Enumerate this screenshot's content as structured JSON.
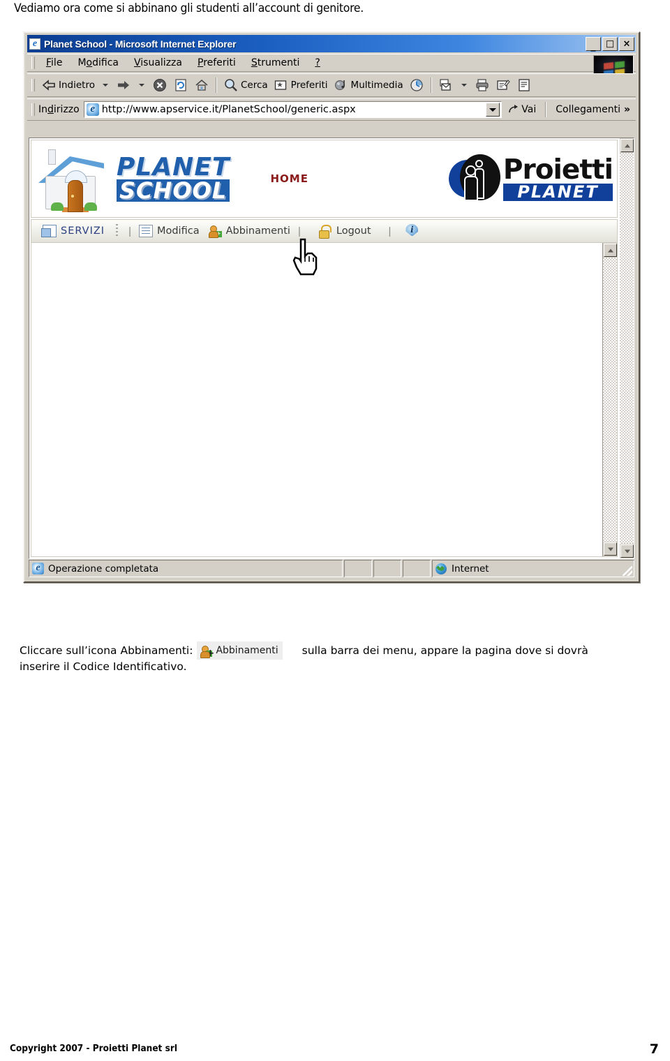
{
  "document": {
    "intro_text": "Vediamo ora come si abbinano gli studenti all’account di genitore.",
    "footer_copyright": "Copyright 2007 - Proietti Planet srl",
    "page_number": "7"
  },
  "browser": {
    "title": "Planet School - Microsoft Internet Explorer",
    "title_icon": "ie-document-icon",
    "window_controls": {
      "minimize": "_",
      "maximize": "□",
      "close": "×"
    },
    "menu": [
      {
        "label": "File",
        "accel": "F"
      },
      {
        "label": "Modifica",
        "accel": "M"
      },
      {
        "label": "Visualizza",
        "accel": "V"
      },
      {
        "label": "Preferiti",
        "accel": "P"
      },
      {
        "label": "Strumenti",
        "accel": "S"
      },
      {
        "label": "?",
        "accel": ""
      }
    ],
    "brand_logo": "windows-flag-logo",
    "toolbar": [
      {
        "name": "back-button",
        "label": "Indietro",
        "icon": "arrow-left-icon",
        "has_dropdown": true
      },
      {
        "name": "forward-button",
        "label": "",
        "icon": "arrow-right-icon",
        "has_dropdown": true
      },
      {
        "name": "stop-button",
        "label": "",
        "icon": "stop-icon",
        "has_dropdown": false
      },
      {
        "name": "refresh-button",
        "label": "",
        "icon": "refresh-icon",
        "has_dropdown": false
      },
      {
        "name": "home-button",
        "label": "",
        "icon": "home-icon",
        "has_dropdown": false
      },
      {
        "name": "search-button",
        "label": "Cerca",
        "icon": "search-icon",
        "has_dropdown": false
      },
      {
        "name": "favorites-button",
        "label": "Preferiti",
        "icon": "star-folder-icon",
        "has_dropdown": false
      },
      {
        "name": "media-button",
        "label": "Multimedia",
        "icon": "media-note-icon",
        "has_dropdown": false
      },
      {
        "name": "history-button",
        "label": "",
        "icon": "history-clock-icon",
        "has_dropdown": false
      },
      {
        "name": "mail-button",
        "label": "",
        "icon": "mail-icon",
        "has_dropdown": true
      },
      {
        "name": "print-button",
        "label": "",
        "icon": "printer-icon",
        "has_dropdown": false
      },
      {
        "name": "edit-button",
        "label": "",
        "icon": "edit-page-icon",
        "has_dropdown": false
      },
      {
        "name": "discuss-button",
        "label": "",
        "icon": "discuss-page-icon",
        "has_dropdown": false
      }
    ],
    "address": {
      "label": "Indirizzo",
      "url": "http://www.apservice.it/PlanetSchool/generic.aspx",
      "icon": "ie-page-icon",
      "go_label": "Vai",
      "links_label": "Collegamenti",
      "links_overflow": "»"
    },
    "status": {
      "message": "Operazione completata",
      "message_icon": "ie-icon",
      "zone_label": "Internet",
      "zone_icon": "globe-icon"
    }
  },
  "site": {
    "logo": {
      "icon": "house-icon",
      "line1": "PLANET",
      "line2": "SCHOOL"
    },
    "home_link": "HOME",
    "partner_logo": {
      "icon": "proietti-figures-icon",
      "name": "Proietti",
      "subtitle": "PLANET"
    },
    "nav": [
      {
        "name": "servizi",
        "label": "SERVIZI",
        "icon": "windows-stack-icon"
      },
      {
        "name": "modifica",
        "label": "Modifica",
        "icon": "document-icon"
      },
      {
        "name": "abbinamenti",
        "label": "Abbinamenti",
        "icon": "user-add-icon"
      },
      {
        "name": "logout",
        "label": "Logout",
        "icon": "padlock-icon"
      },
      {
        "name": "info",
        "label": "",
        "icon": "info-icon"
      }
    ],
    "nav_separator": "|",
    "cursor": "pointing-hand-cursor"
  },
  "caption": {
    "part1": "Cliccare sull’icona Abbinamenti:",
    "chip_label": "Abbinamenti",
    "chip_icon": "user-add-icon",
    "part2": "sulla barra dei menu, appare la pagina dove si dovrà",
    "part3": "inserire il Codice Identificativo."
  }
}
